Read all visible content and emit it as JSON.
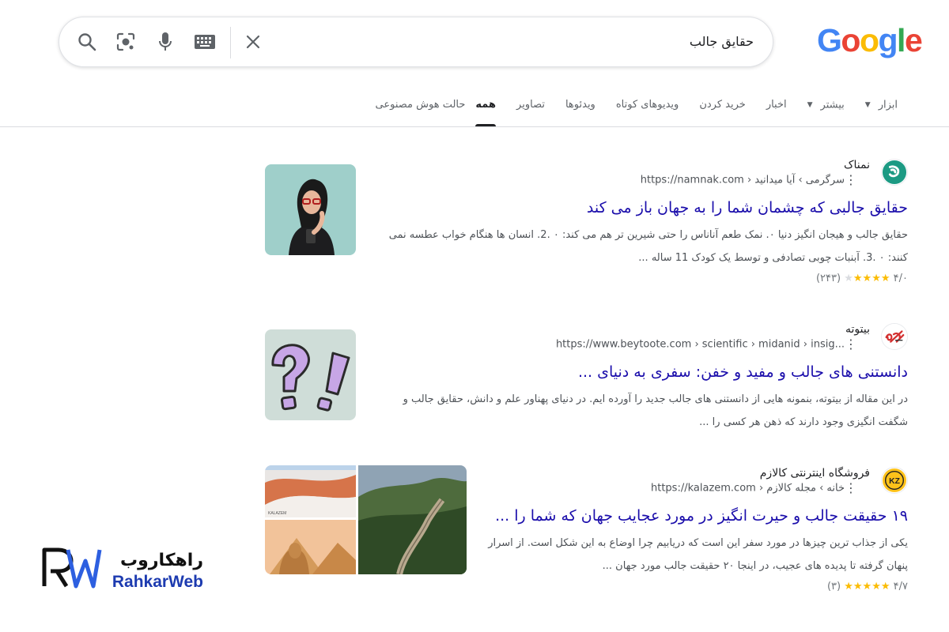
{
  "logo": {
    "letters": [
      "G",
      "o",
      "o",
      "g",
      "l",
      "e"
    ],
    "colors": [
      "#4285F4",
      "#EA4335",
      "#FBBC05",
      "#4285F4",
      "#34A853",
      "#EA4335"
    ]
  },
  "search": {
    "query": "حقایق جالب"
  },
  "tabs": [
    {
      "label": "حالت هوش مصنوعی"
    },
    {
      "label": "همه",
      "active": true
    },
    {
      "label": "تصاویر"
    },
    {
      "label": "ویدئوها"
    },
    {
      "label": "ویدیوهای کوتاه"
    },
    {
      "label": "خرید کردن"
    },
    {
      "label": "اخبار"
    },
    {
      "label": "بیشتر",
      "caret": true
    },
    {
      "label": "ابزار",
      "caret": true
    }
  ],
  "results": [
    {
      "site_name": "نمناک",
      "url": "https://namnak.com › سرگرمی › آیا میدانید",
      "title": "حقایق جالبی که چشمان شما را به جهان باز می کند",
      "snippet": "حقایق جالب و هیجان انگیز دنیا ۰. نمک طعم آناناس را حتی شیرین تر هم می کند: ۰ .2. انسان ها هنگام خواب عطسه نمی کنند: ۰ .3. آبنبات چوبی تصادفی و توسط یک کودک 11 ساله ...",
      "rating": "۴/۰",
      "stars": 4,
      "reviews": "(۲۴۳)"
    },
    {
      "site_name": "بیتوته",
      "url": "https://www.beytoote.com › scientific › midanid › insig...",
      "title": "دانستنی های جالب و مفید و خفن: سفری به دنیای ...",
      "snippet": "در این مقاله از بیتوته، بنمونه هایی از دانستنی های جالب جدید را آورده ایم. در دنیای پهناور علم و دانش، حقایق جالب و شگفت انگیزی وجود دارند که ذهن هر کسی را ..."
    },
    {
      "site_name": "فروشگاه اینترنتی کالازم",
      "url": "https://kalazem.com › خانه › مجله کالازم",
      "title": "۱۹ حقیقت جالب و حیرت انگیز در مورد عجایب جهان که شما را ...",
      "snippet": "یکی از جذاب ترین چیزها در مورد سفر این است که دریابیم چرا اوضاع به این شکل است. از اسرار پنهان گرفته تا پدیده های عجیب، در اینجا ۲۰ حقیقت جالب مورد جهان ...",
      "rating": "۴/۷",
      "stars": 5,
      "reviews": "(۳)",
      "thumb_caption": "KALAZEM"
    }
  ],
  "watermark": {
    "fa": "راهکاروب",
    "en": "RahkarWeb"
  }
}
